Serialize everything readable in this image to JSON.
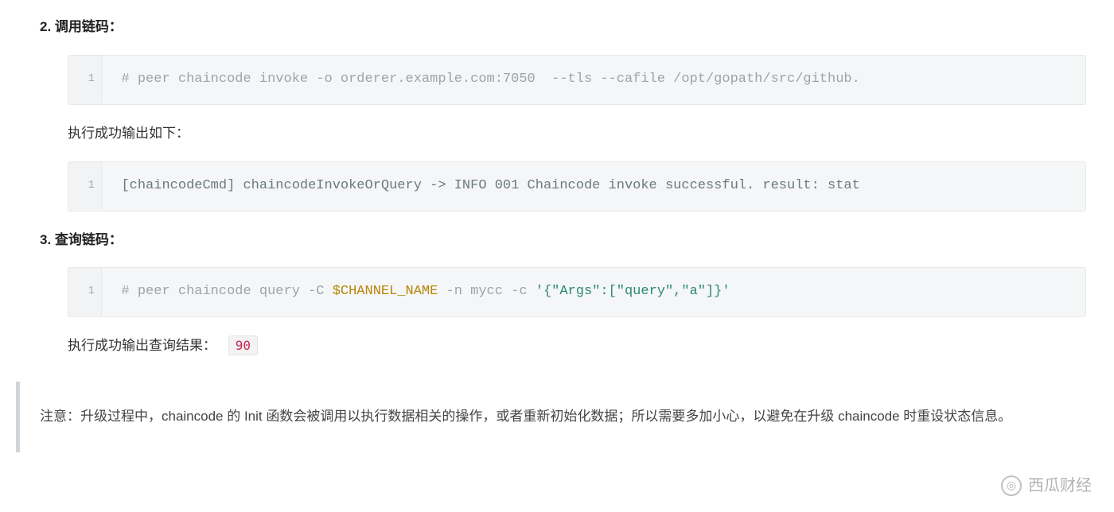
{
  "sections": [
    {
      "number": "2.",
      "title": "调用链码：",
      "code1": {
        "line_no": "1",
        "tokens": [
          {
            "cls": "cm-comment",
            "text": "# peer chaincode invoke -o orderer.example.com:7050  --tls --cafile /opt/gopath/src/github."
          }
        ]
      },
      "after_text": "执行成功输出如下：",
      "code2": {
        "line_no": "1",
        "tokens": [
          {
            "cls": "cm-plain",
            "text": "[chaincodeCmd] chaincodeInvokeOrQuery -> INFO 001 Chaincode invoke successful. result: stat"
          }
        ]
      }
    },
    {
      "number": "3.",
      "title": "查询链码：",
      "code1": {
        "line_no": "1",
        "tokens": [
          {
            "cls": "cm-comment",
            "text": "# peer chaincode query -C "
          },
          {
            "cls": "cm-var",
            "text": "$CHANNEL_NAME"
          },
          {
            "cls": "cm-comment",
            "text": " -n mycc -c "
          },
          {
            "cls": "cm-str",
            "text": "'{\"Args\":[\"query\",\"a\"]}'"
          }
        ]
      },
      "after_text": "执行成功输出查询结果：",
      "inline_value": "90"
    }
  ],
  "note": "注意：升级过程中，chaincode 的 Init 函数会被调用以执行数据相关的操作，或者重新初始化数据；所以需要多加小心，以避免在升级 chaincode 时重设状态信息。",
  "watermark": {
    "icon": "◎",
    "text": "西瓜财经"
  }
}
